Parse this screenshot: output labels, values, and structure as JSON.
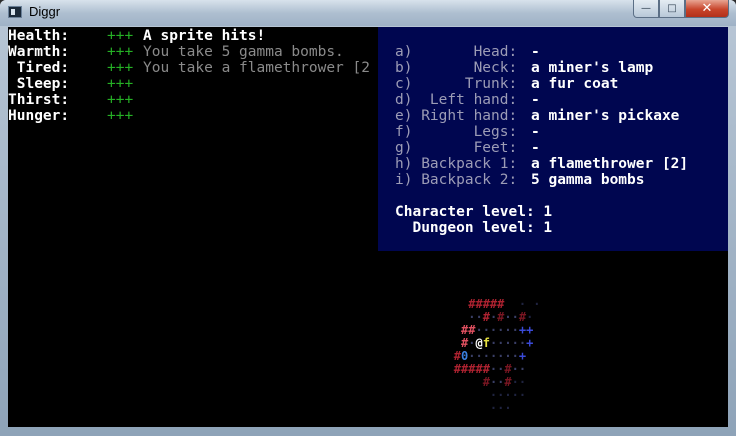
{
  "window": {
    "title": "Diggr",
    "controls": {
      "minimize": "—",
      "maximize": "□",
      "close": "✕"
    }
  },
  "stats": [
    {
      "label": "Health:",
      "value": "+++"
    },
    {
      "label": "Warmth:",
      "value": "+++"
    },
    {
      "label": " Tired:",
      "value": "+++"
    },
    {
      "label": " Sleep:",
      "value": "+++"
    },
    {
      "label": "Thirst:",
      "value": "+++"
    },
    {
      "label": "Hunger:",
      "value": "+++"
    }
  ],
  "messages": [
    "A sprite hits!",
    "You take 5 gamma bombs.",
    "You take a flamethrower [2"
  ],
  "inventory": {
    "slots": [
      {
        "key": "a)       Head:",
        "value": "-"
      },
      {
        "key": "b)       Neck:",
        "value": "a miner's lamp"
      },
      {
        "key": "c)      Trunk:",
        "value": "a fur coat"
      },
      {
        "key": "d)  Left hand:",
        "value": "-"
      },
      {
        "key": "e) Right hand:",
        "value": "a miner's pickaxe"
      },
      {
        "key": "f)       Legs:",
        "value": "-"
      },
      {
        "key": "g)       Feet:",
        "value": "-"
      },
      {
        "key": "h) Backpack 1:",
        "value": "a flamethrower [2]"
      },
      {
        "key": "i) Backpack 2:",
        "value": "5 gamma bombs"
      }
    ],
    "character_level": "Character level: 1",
    "dungeon_level": "  Dungeon level: 1"
  },
  "map": {
    "rows": [
      "  #####  · ·",
      "  ··#·#··#·",
      " ##······++",
      " #·@f·····+",
      "#0·······+",
      "#####··#··",
      "    #··#··",
      "     ·····",
      "     ··· "
    ],
    "player_glyph": "@",
    "monster_glyph": "f",
    "item_glyph": "0"
  },
  "colors": {
    "stat_bar": "#25b025",
    "inventory_bg": "#000650",
    "wall": "#ad2230",
    "player": "#ffffff",
    "monster": "#e6e040",
    "item": "#3b7fe0"
  }
}
